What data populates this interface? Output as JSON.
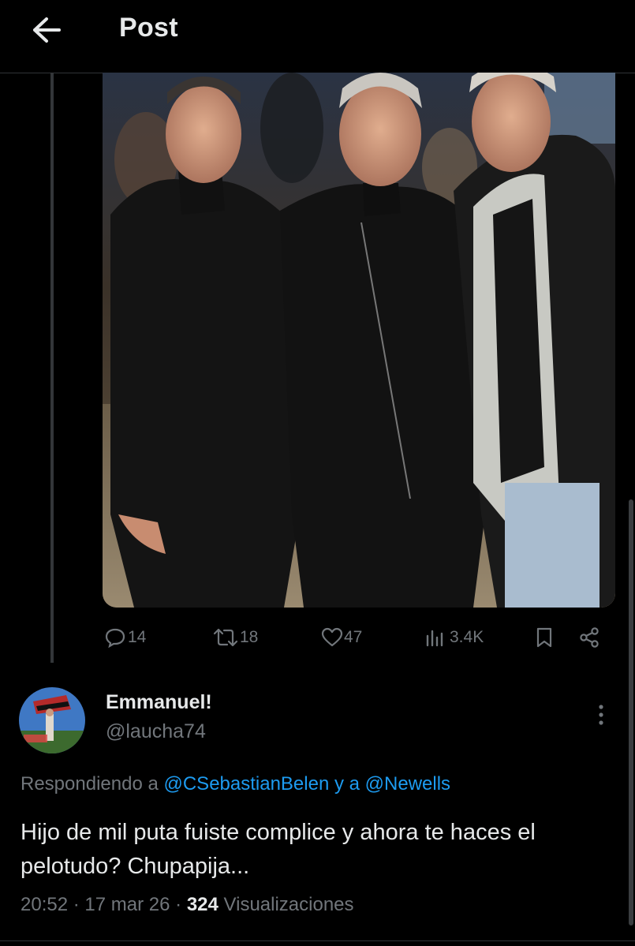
{
  "header": {
    "title": "Post"
  },
  "post": {
    "media_description": "",
    "stats": {
      "replies": "14",
      "reposts": "18",
      "likes": "47",
      "views": "3.4K"
    }
  },
  "reply": {
    "display_name": "Emmanuel!",
    "handle": "@laucha74",
    "replying_prefix": "Respondiendo a",
    "replying_mention_1": "@CSebastianBelen",
    "replying_joiner": "y a",
    "replying_mention_2": "@Newells",
    "text": "Hijo de mil puta fuiste complice y ahora te haces el pelotudo? Chupapija...",
    "time": "20:52",
    "date": "17 mar 26",
    "views_count": "324",
    "views_label": "Visualizaciones",
    "separator": "·"
  },
  "colors": {
    "background": "#000000",
    "text_primary": "#e7e9ea",
    "text_secondary": "#71767b",
    "link": "#1d9bf0",
    "border": "#2f3336"
  },
  "icons": {
    "back": "arrow-left-icon",
    "reply": "speech-bubble-icon",
    "repost": "repost-icon",
    "like": "heart-icon",
    "views": "bar-chart-icon",
    "bookmark": "bookmark-icon",
    "share": "share-icon",
    "more": "vertical-dots-icon"
  }
}
